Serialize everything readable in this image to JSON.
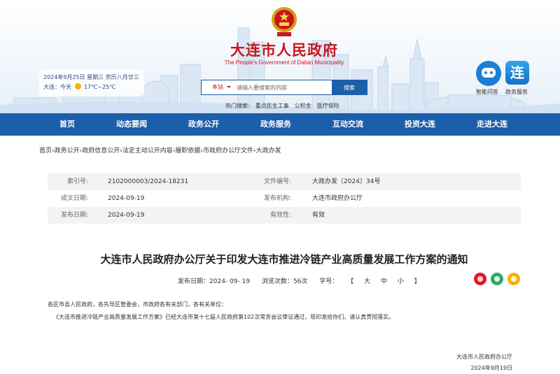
{
  "header": {
    "title": "大连市人民政府",
    "subtitle": "The People's Government of Dalian Municipality",
    "weather_date": "2024年9月25日 星期三 农历八月廿三",
    "weather_city": "大连：今天",
    "weather_temp": "17℃~25℃",
    "search_scope": "本站",
    "search_placeholder": "请输入要搜索的内容",
    "search_button": "搜索",
    "hot_label": "热门搜索:",
    "hot_links": [
      "重点民生工事",
      "公积金",
      "医疗保险"
    ],
    "assistant_label": "智能问答",
    "service_label": "政务服务",
    "service_icon_text": "连"
  },
  "nav": [
    "首页",
    "动态要闻",
    "政务公开",
    "政务服务",
    "互动交流",
    "投资大连",
    "走进大连"
  ],
  "breadcrumb": "首页›政务公开›政府信息公开›法定主动公开内容›履职依据›市政府办公厅文件›大政办发",
  "meta": {
    "index_label": "索引号:",
    "index_value": "2102000003/2024-18231",
    "docno_label": "文件编号:",
    "docno_value": "大政办发〔2024〕34号",
    "created_label": "成文日期:",
    "created_value": "2024-09-19",
    "issuer_label": "发布机构:",
    "issuer_value": "大连市政府办公厅",
    "published_label": "发布日期:",
    "published_value": "2024-09-19",
    "validity_label": "有效性:",
    "validity_value": "有效"
  },
  "article": {
    "title": "大连市人民政府办公厅关于印发大连市推进冷链产业高质量发展工作方案的通知",
    "date_label": "发布日期：",
    "date_value": "2024- 09- 19",
    "views_label": "浏览次数：",
    "views_value": "56次",
    "font_label": "字号：",
    "bracket_open": "【",
    "size_large": "大",
    "size_medium": "中",
    "size_small": "小",
    "bracket_close": "】",
    "salutation": "各区市县人民政府，各先导区管委会，市政府各有关部门，各有关单位：",
    "paragraph": "《大连市推进冷链产业高质量发展工作方案》已经大连市第十七届人民政府第102次常务会议审议通过，现印发给你们，请认真贯彻落实。",
    "signer": "大连市人民政府办公厅",
    "sign_date": "2024年9月19日"
  },
  "colors": {
    "brand_red": "#c8161d",
    "brand_blue": "#1b5eaa",
    "weibo": "#e6162d",
    "wechat": "#2aae67",
    "qzone": "#f5b400"
  },
  "share_icons": [
    "weibo-icon",
    "wechat-icon",
    "qzone-icon"
  ]
}
